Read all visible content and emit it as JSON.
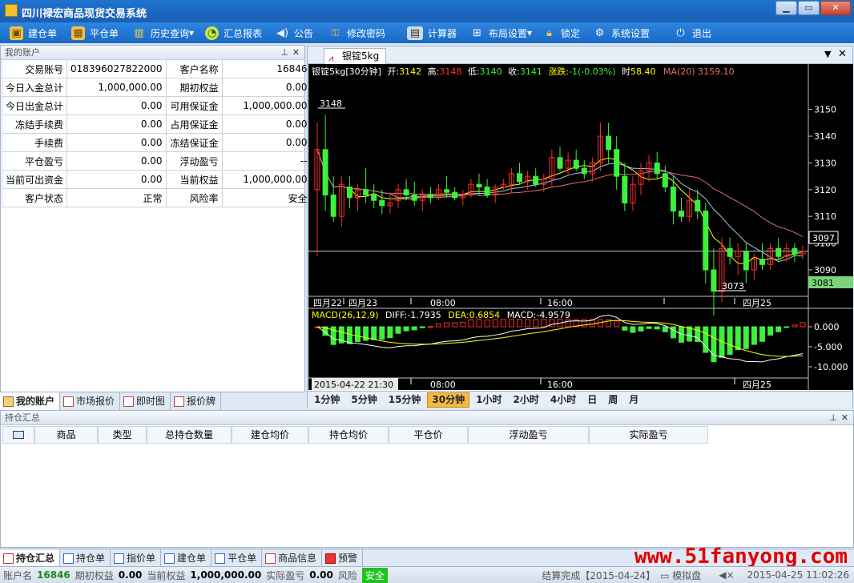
{
  "window": {
    "title": "四川禄宏商品现货交易系统"
  },
  "toolbar": [
    {
      "label": "建仓单",
      "icon": "build-order-icon",
      "color": "#7cc3ff"
    },
    {
      "label": "平仓单",
      "icon": "close-order-icon",
      "color": "#f4c04a"
    },
    {
      "label": "历史查询",
      "icon": "history-chart-icon",
      "color": "#ffd84a",
      "dropdown": "▾"
    },
    {
      "label": "汇总报表",
      "icon": "report-icon",
      "color": "#b8e34a"
    },
    {
      "label": "公告",
      "icon": "speaker-icon",
      "color": "#e6f0ff"
    },
    {
      "label": "修改密码",
      "icon": "key-icon",
      "color": "#f4c04a"
    },
    {
      "label": "计算器",
      "icon": "calculator-icon",
      "color": "#cfd8e6"
    },
    {
      "label": "布局设置",
      "icon": "layout-icon",
      "color": "#ffffff",
      "dropdown": "▾"
    },
    {
      "label": "锁定",
      "icon": "lock-icon",
      "color": "#f4c04a"
    },
    {
      "label": "系统设置",
      "icon": "gear-icon",
      "color": "#ffffff"
    },
    {
      "label": "退出",
      "icon": "power-icon",
      "color": "#ffffff"
    }
  ],
  "account": {
    "title": "我的账户",
    "rows": [
      [
        "交易账号",
        "018396027822000",
        "客户名称",
        "16846"
      ],
      [
        "今日入金总计",
        "1,000,000.00",
        "期初权益",
        "0.00"
      ],
      [
        "今日出金总计",
        "0.00",
        "可用保证金",
        "1,000,000.00"
      ],
      [
        "冻结手续费",
        "0.00",
        "占用保证金",
        "0.00"
      ],
      [
        "手续费",
        "0.00",
        "冻结保证金",
        "0.00"
      ],
      [
        "平仓盈亏",
        "0.00",
        "浮动盈亏",
        "--"
      ],
      [
        "当前可出资金",
        "0.00",
        "当前权益",
        "1,000,000.00"
      ],
      [
        "客户状态",
        "正常",
        "风险率",
        "安全"
      ]
    ],
    "tabs": [
      "我的账户",
      "市场报价",
      "即时图",
      "报价牌"
    ]
  },
  "chart": {
    "tab": "银锭5kg",
    "info": {
      "name": "银锭5kg",
      "period": "[30分钟]",
      "open_label": "开:",
      "open": "3142",
      "high_label": "高:",
      "high": "3148",
      "low_label": "低:",
      "low": "3140",
      "close_label": "收:",
      "close": "3141",
      "change_label": "涨跌:",
      "change": "-1(-0.03%)",
      "time_label": "时",
      "time": "58.40",
      "ma": "MA(20) 3159.10"
    },
    "macd": {
      "label": "MACD(26,12,9)",
      "diff": "DIFF:-1.7935",
      "dea": "DEA:0.6854",
      "macd": "MACD:-4.9579"
    },
    "price_ticks": [
      "3150",
      "3140",
      "3130",
      "3120",
      "3110",
      "3100",
      "3090"
    ],
    "macd_ticks": [
      "0.000",
      "-5.000",
      "-10.000"
    ],
    "high_marker": "3148",
    "low_marker": "3073",
    "last_price": "3097",
    "cursor_price": "3081",
    "time_labels": [
      "四月22",
      "四月23",
      "08:00",
      "16:00",
      "四月25"
    ],
    "cursor_time": "2015-04-22 21:30",
    "periods": [
      "1分钟",
      "5分钟",
      "15分钟",
      "30分钟",
      "1小时",
      "2小时",
      "4小时",
      "日",
      "周",
      "月"
    ],
    "active_period": "30分钟",
    "colors": {
      "up": "#ff2a2a",
      "down": "#3cf03c",
      "ma1": "#ffff00",
      "ma2": "#9ec9e8",
      "ma3": "#e07070"
    }
  },
  "chart_data": {
    "type": "candlestick",
    "ohlc": [
      [
        3120,
        3145,
        3095,
        3135
      ],
      [
        3135,
        3148,
        3112,
        3118
      ],
      [
        3118,
        3125,
        3108,
        3110
      ],
      [
        3110,
        3125,
        3106,
        3122
      ],
      [
        3121,
        3125,
        3113,
        3117
      ],
      [
        3117,
        3122,
        3112,
        3120
      ],
      [
        3120,
        3128,
        3115,
        3118
      ],
      [
        3118,
        3122,
        3113,
        3116
      ],
      [
        3116,
        3120,
        3111,
        3114
      ],
      [
        3114,
        3119,
        3111,
        3115
      ],
      [
        3116,
        3122,
        3113,
        3120
      ],
      [
        3120,
        3124,
        3116,
        3118
      ],
      [
        3118,
        3123,
        3114,
        3116
      ],
      [
        3116,
        3120,
        3112,
        3118
      ],
      [
        3118,
        3121,
        3115,
        3117
      ],
      [
        3117,
        3122,
        3116,
        3120
      ],
      [
        3120,
        3125,
        3117,
        3119
      ],
      [
        3119,
        3121,
        3116,
        3117
      ],
      [
        3117,
        3120,
        3114,
        3118
      ],
      [
        3118,
        3124,
        3117,
        3122
      ],
      [
        3122,
        3126,
        3118,
        3121
      ],
      [
        3121,
        3124,
        3117,
        3118
      ],
      [
        3118,
        3122,
        3115,
        3121
      ],
      [
        3121,
        3124,
        3120,
        3122
      ],
      [
        3122,
        3128,
        3119,
        3126
      ],
      [
        3126,
        3130,
        3122,
        3123
      ],
      [
        3123,
        3127,
        3120,
        3125
      ],
      [
        3125,
        3128,
        3121,
        3122
      ],
      [
        3122,
        3126,
        3119,
        3124
      ],
      [
        3124,
        3135,
        3121,
        3132
      ],
      [
        3132,
        3136,
        3127,
        3128
      ],
      [
        3128,
        3134,
        3125,
        3131
      ],
      [
        3131,
        3135,
        3127,
        3128
      ],
      [
        3128,
        3131,
        3124,
        3126
      ],
      [
        3126,
        3132,
        3123,
        3130
      ],
      [
        3130,
        3145,
        3127,
        3140
      ],
      [
        3140,
        3145,
        3130,
        3135
      ],
      [
        3135,
        3140,
        3120,
        3125
      ],
      [
        3125,
        3130,
        3112,
        3115
      ],
      [
        3115,
        3125,
        3112,
        3122
      ],
      [
        3122,
        3130,
        3118,
        3127
      ],
      [
        3127,
        3133,
        3123,
        3130
      ],
      [
        3130,
        3134,
        3124,
        3126
      ],
      [
        3126,
        3129,
        3119,
        3121
      ],
      [
        3121,
        3125,
        3107,
        3112
      ],
      [
        3112,
        3117,
        3108,
        3110
      ],
      [
        3110,
        3120,
        3108,
        3116
      ],
      [
        3116,
        3120,
        3109,
        3112
      ],
      [
        3112,
        3115,
        3085,
        3090
      ],
      [
        3090,
        3098,
        3073,
        3082
      ],
      [
        3082,
        3102,
        3078,
        3098
      ],
      [
        3098,
        3102,
        3092,
        3095
      ],
      [
        3095,
        3100,
        3088,
        3097
      ],
      [
        3097,
        3100,
        3085,
        3090
      ],
      [
        3090,
        3096,
        3086,
        3094
      ],
      [
        3094,
        3100,
        3090,
        3092
      ],
      [
        3092,
        3100,
        3090,
        3098
      ],
      [
        3098,
        3102,
        3094,
        3095
      ],
      [
        3095,
        3100,
        3093,
        3098
      ],
      [
        3098,
        3100,
        3093,
        3096
      ],
      [
        3096,
        3099,
        3094,
        3097
      ]
    ],
    "ylim": [
      3081,
      3158
    ],
    "y_ticks": [
      3150,
      3140,
      3130,
      3120,
      3110,
      3100,
      3090
    ],
    "x_labels": [
      "四月22",
      "四月23",
      "08:00",
      "16:00",
      "四月25"
    ],
    "ma": {
      "name": "MA(20)",
      "last": 3159.1
    },
    "macd": {
      "diff": -1.7935,
      "dea": 0.6854,
      "macd": -4.9579,
      "ylim": [
        -12,
        2
      ],
      "y_ticks": [
        0,
        -5,
        -10
      ]
    }
  },
  "positions": {
    "title": "持仓汇总",
    "columns": [
      "商品",
      "类型",
      "总持仓数量",
      "建仓均价",
      "持仓均价",
      "平仓价",
      "浮动盈亏",
      "实际盈亏"
    ]
  },
  "bottom_tabs": [
    "持仓汇总",
    "持仓单",
    "指价单",
    "建仓单",
    "平仓单",
    "商品信息",
    "预警"
  ],
  "status": {
    "account_label": "账户名",
    "account": "16846",
    "init_label": "期初权益",
    "init": "0.00",
    "equity_label": "当前权益",
    "equity": "1,000,000.00",
    "pnl_label": "实际盈亏",
    "pnl": "0.00",
    "risk_label": "风险",
    "risk": "安全",
    "settle": "结算完成【2015-04-24】",
    "mode": "模拟盘",
    "datetime": "2015-04-25 11:02:26"
  },
  "watermark": "www.51fanyong.com"
}
